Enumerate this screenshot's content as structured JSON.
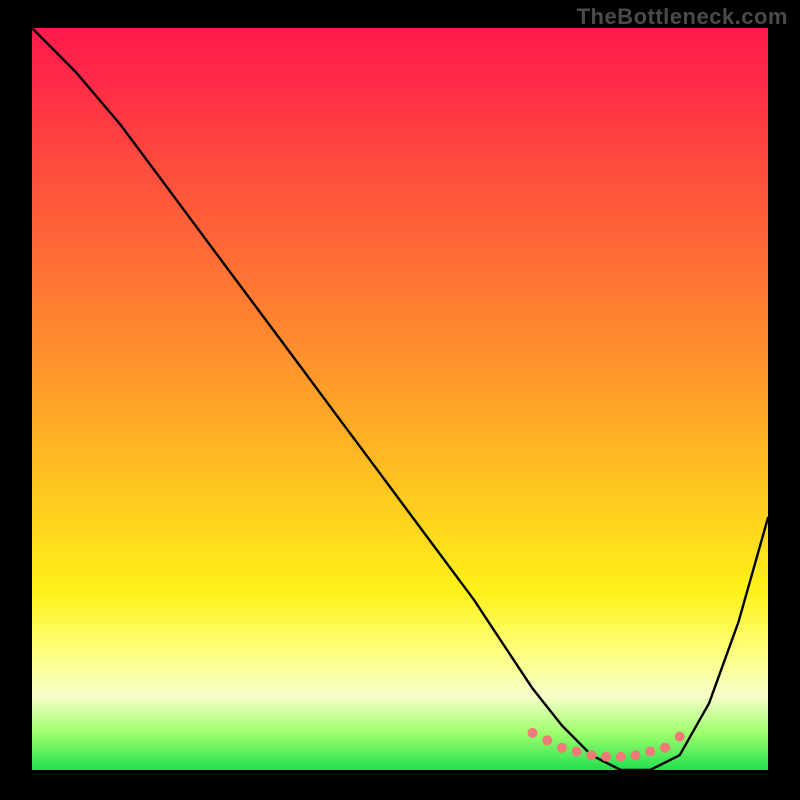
{
  "watermark": "TheBottleneck.com",
  "chart_data": {
    "type": "line",
    "title": "",
    "xlabel": "",
    "ylabel": "",
    "xlim": [
      0,
      100
    ],
    "ylim": [
      0,
      100
    ],
    "grid": false,
    "series": [
      {
        "name": "bottleneck-curve",
        "x": [
          0,
          6,
          12,
          18,
          24,
          30,
          36,
          42,
          48,
          54,
          60,
          64,
          68,
          72,
          76,
          80,
          84,
          88,
          92,
          96,
          100
        ],
        "values": [
          100,
          94,
          87,
          79,
          71,
          63,
          55,
          47,
          39,
          31,
          23,
          17,
          11,
          6,
          2,
          0,
          0,
          2,
          9,
          20,
          34
        ]
      },
      {
        "name": "optimal-dots",
        "x": [
          68,
          70,
          72,
          74,
          76,
          78,
          80,
          82,
          84,
          86,
          88
        ],
        "values": [
          5,
          4,
          3,
          2.5,
          2,
          1.8,
          1.8,
          2,
          2.5,
          3,
          4.5
        ]
      }
    ],
    "colors": {
      "curve_stroke": "#000000",
      "dot_fill": "#ef7a78"
    }
  }
}
